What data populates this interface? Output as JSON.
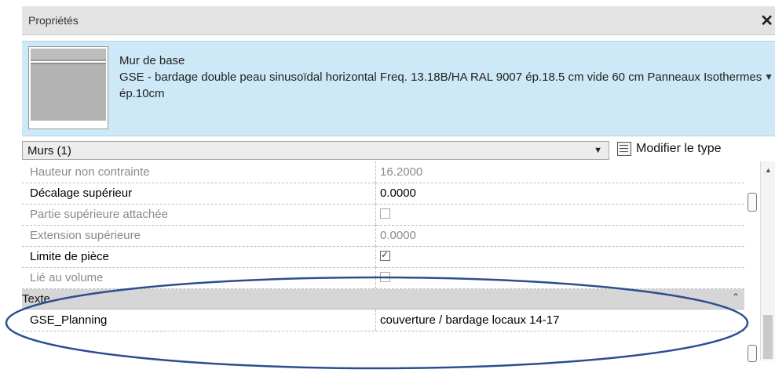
{
  "window": {
    "title": "Propriétés",
    "close_symbol": "✕"
  },
  "type_selector": {
    "family": "Mur de base",
    "type_name": "GSE - bardage double peau sinusoïdal horizontal Freq. 13.18B/HA RAL 9007 ép.18.5 cm vide 60 cm Panneaux Isothermes ép.10cm",
    "dropdown_symbol": "▼"
  },
  "filter": {
    "label": "Murs (1)",
    "dropdown_symbol": "▼",
    "edit_type_label": "Modifier le type"
  },
  "properties": [
    {
      "name": "Hauteur non contrainte",
      "value": "16.2000",
      "enabled": false
    },
    {
      "name": "Décalage supérieur",
      "value": "0.0000",
      "enabled": true
    },
    {
      "name": "Partie supérieure attachée",
      "checkbox": false,
      "enabled": false
    },
    {
      "name": "Extension supérieure",
      "value": "0.0000",
      "enabled": false
    },
    {
      "name": "Limite de pièce",
      "checkbox": true,
      "enabled": true
    },
    {
      "name": "Lié au volume",
      "checkbox": false,
      "enabled": false
    }
  ],
  "group": {
    "name": "Texte",
    "collapse_symbol": "⌃"
  },
  "group_rows": [
    {
      "name": "GSE_Planning",
      "value": "couverture / bardage locaux 14-17"
    }
  ],
  "colors": {
    "highlight_bg": "#cde8f7",
    "annotation_ellipse": "#2c4e8f",
    "group_bg": "#d6d6d6"
  }
}
